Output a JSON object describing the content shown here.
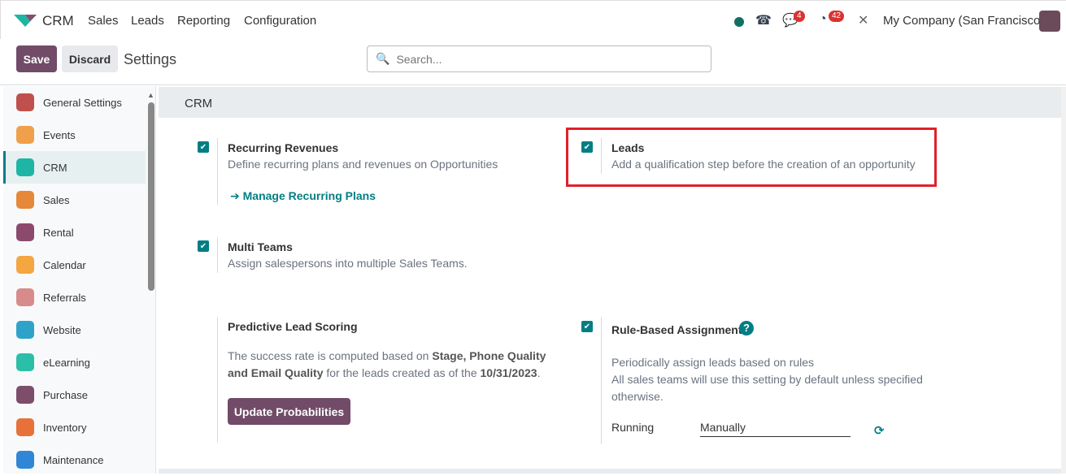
{
  "nav": {
    "app": "CRM",
    "menu": [
      "Sales",
      "Leads",
      "Reporting",
      "Configuration"
    ],
    "chat_count": "4",
    "activity_count": "42",
    "company": "My Company (San Francisco)"
  },
  "control": {
    "save": "Save",
    "discard": "Discard",
    "title": "Settings",
    "search_placeholder": "Search..."
  },
  "sidebar": {
    "items": [
      {
        "label": "General Settings",
        "color": "#c0504d"
      },
      {
        "label": "Events",
        "color": "#f0a04b"
      },
      {
        "label": "CRM",
        "color": "#1fb5a4",
        "active": true
      },
      {
        "label": "Sales",
        "color": "#e5883a"
      },
      {
        "label": "Rental",
        "color": "#8b4a6b"
      },
      {
        "label": "Calendar",
        "color": "#f4a640"
      },
      {
        "label": "Referrals",
        "color": "#d88b8b"
      },
      {
        "label": "Website",
        "color": "#2ea3c9"
      },
      {
        "label": "eLearning",
        "color": "#2bbfa8"
      },
      {
        "label": "Purchase",
        "color": "#7d4e6a"
      },
      {
        "label": "Inventory",
        "color": "#e8713a"
      },
      {
        "label": "Maintenance",
        "color": "#2f86d6"
      }
    ]
  },
  "section": {
    "title": "CRM"
  },
  "settings": {
    "recurring": {
      "title": "Recurring Revenues",
      "desc": "Define recurring plans and revenues on Opportunities",
      "link": "Manage Recurring Plans",
      "checked": true
    },
    "leads": {
      "title": "Leads",
      "desc": "Add a qualification step before the creation of an opportunity",
      "checked": true
    },
    "multi": {
      "title": "Multi Teams",
      "desc": "Assign salespersons into multiple Sales Teams.",
      "checked": true
    },
    "pls": {
      "title": "Predictive Lead Scoring",
      "t1": "The success rate is computed based on ",
      "b1": "Stage, Phone Quality and Email Quality",
      "t2": " for the leads created as of the ",
      "b2": "10/31/2023",
      "t3": ".",
      "button": "Update Probabilities"
    },
    "rule": {
      "title": "Rule-Based Assignment",
      "d1": "Periodically assign leads based on rules",
      "d2": "All sales teams will use this setting by default unless specified otherwise.",
      "running_label": "Running",
      "running_value": "Manually",
      "checked": true
    }
  },
  "colors": {
    "primary": "#714b67",
    "accent": "#017e84",
    "highlight": "#e0202a"
  }
}
